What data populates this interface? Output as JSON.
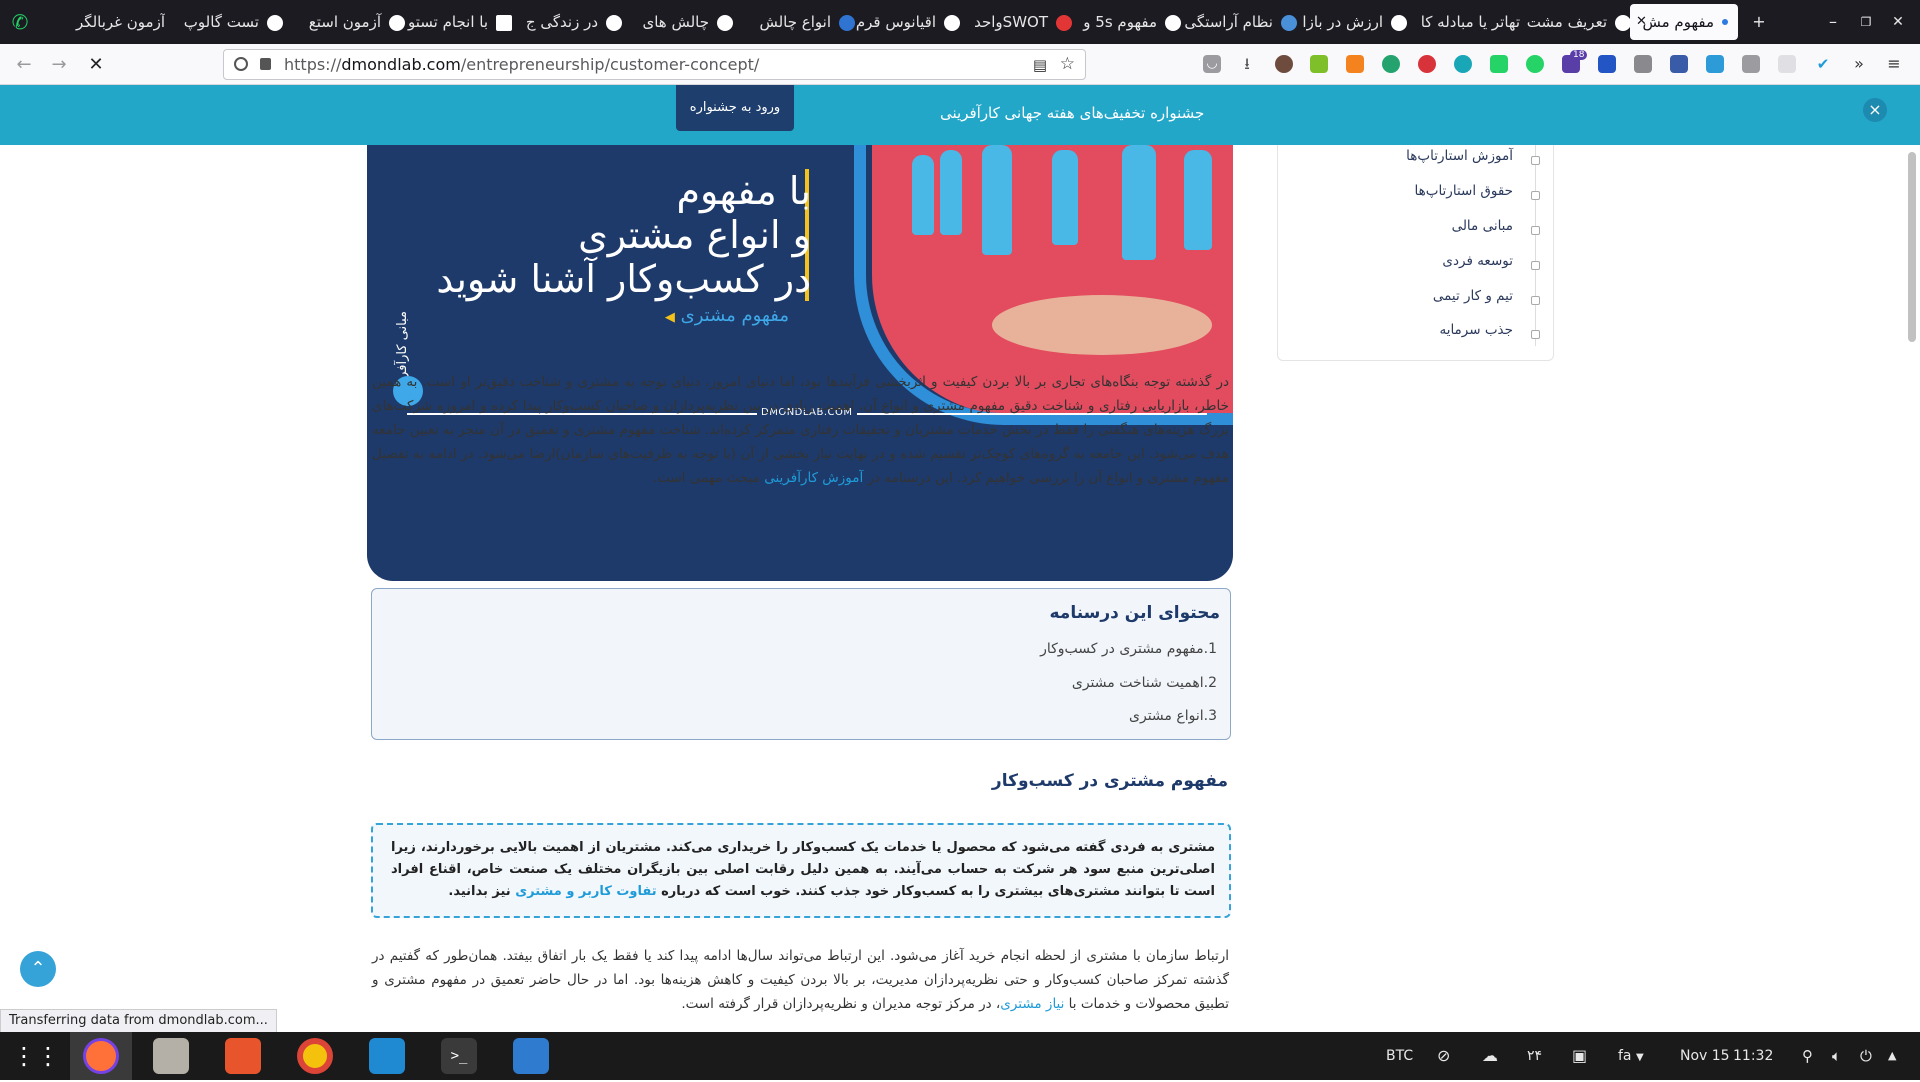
{
  "browser": {
    "tabs": [
      {
        "label": "مفهوم مش",
        "active": true,
        "color": "#2b7be0"
      },
      {
        "label": "تعریف مشت",
        "active": false,
        "color": "#ffffff"
      },
      {
        "label": "تهاتر یا مبادله کا",
        "active": false,
        "color": "#ffffff"
      },
      {
        "label": "ارزش در بازا",
        "active": false,
        "color": "#ffffff"
      },
      {
        "label": "نظام آراستگی",
        "active": false,
        "color": "#ffffff"
      },
      {
        "label": "مفهوم 5s و",
        "active": false,
        "color": "#ffffff"
      },
      {
        "label": "SWOTواحد",
        "active": false,
        "color": "#e23636"
      },
      {
        "label": "اقیانوس قرم",
        "active": false,
        "color": "#ffffff"
      },
      {
        "label": "انواع چالش",
        "active": false,
        "color": "#2f74d0"
      },
      {
        "label": "چالش های",
        "active": false,
        "color": "#ffffff"
      },
      {
        "label": "در زندگی ج",
        "active": false,
        "color": "#ffffff"
      },
      {
        "label": "با انجام تستو",
        "active": false,
        "color": "#ffffff"
      },
      {
        "label": "آزمون استع",
        "active": false,
        "color": "#ffffff"
      },
      {
        "label": "تست گالوپ",
        "active": false,
        "color": "#ffffff"
      },
      {
        "label": "آزمون غربالگر",
        "active": false,
        "color": "#ffffff"
      }
    ],
    "new_tab": "+",
    "minimize": "–",
    "restore": "❐",
    "close": "✕",
    "url_host": "dmondlab.com",
    "url_scheme": "https://",
    "url_path": "/entrepreneurship/customer-concept/",
    "extension_badge": "18"
  },
  "promo": {
    "text": "جشنواره تخفیف‌های هفته جهانی کارآفرینی",
    "button": "ورود به جشنواره",
    "close": "×"
  },
  "hero": {
    "line1": "با مفهوم",
    "line2": "و انواع مشتری",
    "line3": "در کسب‌وکار آشنا شوید",
    "link": "مفهوم مشتری",
    "vertical": "مبانی کارآفرینی",
    "domain": "DMONDLAB.COM"
  },
  "sidebar": {
    "items": [
      "آموزش استارتاپ‌ها",
      "حقوق استارتاپ‌ها",
      "مبانی مالی",
      "توسعه فردی",
      "تیم و کار تیمی",
      "جذب سرمایه"
    ]
  },
  "article": {
    "intro_before_link": "در گذشته توجه بنگاه‌های تجاری بر بالا بردن کیفیت و اثربخشی فرآیندها بود، اما دنیای امروز، دنیای توجه به مشتری و شناخت دقیق‌تر او است. به همین خاطر، بازاریابی رفتاری و شناخت دقیق مفهوم مشتری و انواع آن، اهمیت زیادی در بین نظریه‌پردازان و صاحبان کسب‌وکار پیدا کرده و امروزه شرکت‌های بزرگ هزینه‌های هنگفتی را فقط در بخش خدمات مشتریان و تحقیقات رفتاری متمرکز کرده‌اند. شناخت مفهوم مشتری و تعمیق در آن منجر به تعیین جامعه هدف می‌شود. این جامعه به گروه‌های کوچک‌تر تقسیم شده و در نهایت نیاز بخشی از آن (با توجه به ظرفیت‌های سازمان)ارضا می‌شود. در ادامه به تفصیل مفهوم مشتری و انواع آن را بررسی خواهیم کرد. این درسنامه در ",
    "intro_link": "آموزش کارآفرینی",
    "intro_after_link": " مبحث مهمی است.",
    "toc_title": "محتوای این درسنامه",
    "toc_items": [
      "1.مفهوم مشتری در کسب‌وکار",
      "2.اهمیت شناخت مشتری",
      "3.انواع مشتری"
    ],
    "section_title": "مفهوم مشتری در کسب‌وکار",
    "callout_before_link": "مشتری به فردی گفته می‌شود که محصول یا خدمات یک کسب‌وکار را خریداری می‌کند. مشتریان از اهمیت بالایی برخوردارند، زیرا اصلی‌ترین منبع سود هر شرکت به حساب می‌آیند. به همین دلیل رقابت اصلی بین بازیگران مختلف یک صنعت خاص، اقناع افراد است تا بتوانند مشتری‌های بیشتری را به کسب‌وکار خود جذب کنند. خوب است که درباره ",
    "callout_link": "تفاوت کاربر و مشتری",
    "callout_after_link": " نیز بدانید.",
    "para2_before_link": "ارتباط سازمان با مشتری از لحظه انجام خرید آغاز می‌شود. این ارتباط می‌تواند سال‌ها ادامه پیدا کند یا فقط یک بار اتفاق بیفتد. همان‌طور که گفتیم در گذشته تمرکز صاحبان کسب‌وکار و حتی نظریه‌پردازان مدیریت، بر بالا بردن کیفیت و کاهش هزینه‌ها بود. اما در حال حاضر تعمیق در مفهوم مشتری و تطبیق محصولات و خدمات با ",
    "para2_link": "نیاز مشتری",
    "para2_after_link": "، در مرکز توجه مدیران و نظریه‌پردازان قرار گرفته است."
  },
  "status_text": "Transferring data from dmondlab.com...",
  "taskbar": {
    "apps": [
      "app-grid-icon",
      "firefox-icon",
      "files-icon",
      "software-center-icon",
      "chrome-icon",
      "vscode-icon",
      "terminal-icon",
      "text-editor-icon"
    ],
    "tray_btc": "BTC",
    "tray_num": "۲۴",
    "tray_lang": "fa",
    "tray_date": "Nov 15",
    "tray_time": "11:32"
  },
  "colors": {
    "accent_blue": "#23a7c9",
    "navy": "#1e3a6a",
    "link": "#1f9bd8"
  }
}
